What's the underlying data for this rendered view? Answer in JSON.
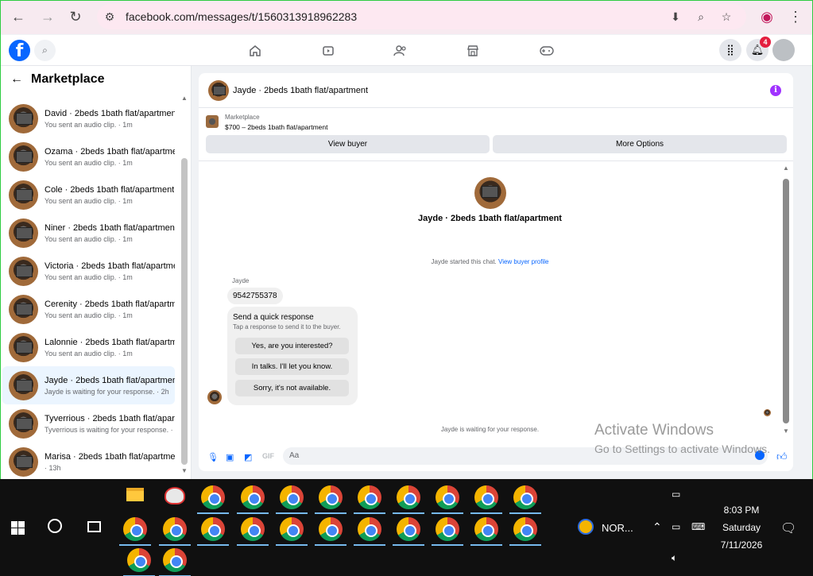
{
  "browser": {
    "url": "facebook.com/messages/t/1560313918962283",
    "back_icon": "arrow-left-icon",
    "forward_icon": "arrow-right-icon",
    "reload_icon": "reload-icon"
  },
  "header": {
    "logo": "f",
    "notification_count": "4"
  },
  "sidebar": {
    "title": "Marketplace",
    "conversations": [
      {
        "name": "David · 2beds 1bath flat/apartment",
        "sub": "You sent an audio clip. · 1m"
      },
      {
        "name": "Ozama · 2beds 1bath flat/apartment",
        "sub": "You sent an audio clip. · 1m"
      },
      {
        "name": "Cole · 2beds 1bath flat/apartment",
        "sub": "You sent an audio clip. · 1m"
      },
      {
        "name": "Niner · 2beds 1bath flat/apartment",
        "sub": "You sent an audio clip. · 1m"
      },
      {
        "name": "Victoria · 2beds 1bath flat/apartment",
        "sub": "You sent an audio clip. · 1m"
      },
      {
        "name": "Cerenity · 2beds 1bath flat/apartment",
        "sub": "You sent an audio clip. · 1m"
      },
      {
        "name": "Lalonnie · 2beds 1bath flat/apartment",
        "sub": "You sent an audio clip. · 1m"
      },
      {
        "name": "Jayde · 2beds 1bath flat/apartment",
        "sub": "Jayde is waiting for your response. · 2h"
      },
      {
        "name": "Tyverrious · 2beds 1bath flat/apartment",
        "sub": "Tyverrious is waiting for your response. · 9h"
      },
      {
        "name": "Marisa · 2beds 1bath flat/apartment",
        "sub": "· 13h"
      }
    ]
  },
  "chat": {
    "title": "Jayde · 2beds 1bath flat/apartment",
    "marketplace_label": "Marketplace",
    "listing": "$700 – 2beds 1bath flat/apartment",
    "view_buyer": "View buyer",
    "more_options": "More Options",
    "profile_name": "Jayde · 2beds 1bath flat/apartment",
    "started": "Jayde started this chat.",
    "view_profile": "View buyer profile",
    "sender": "Jayde",
    "phone": "9542755378",
    "quick_title": "Send a quick response",
    "quick_sub": "Tap a response to send it to the buyer.",
    "quick_1": "Yes, are you interested?",
    "quick_2": "In talks. I'll let you know.",
    "quick_3": "Sorry, it's not available.",
    "waiting": "Jayde is waiting for your response.",
    "composer_placeholder": "Aa"
  },
  "watermark": {
    "line1": "Activate Windows",
    "line2": "Go to Settings to activate Windows."
  },
  "taskbar": {
    "norton_label": "NOR...",
    "time": "8:03 PM",
    "day": "Saturday",
    "date": "7/11/2026"
  }
}
